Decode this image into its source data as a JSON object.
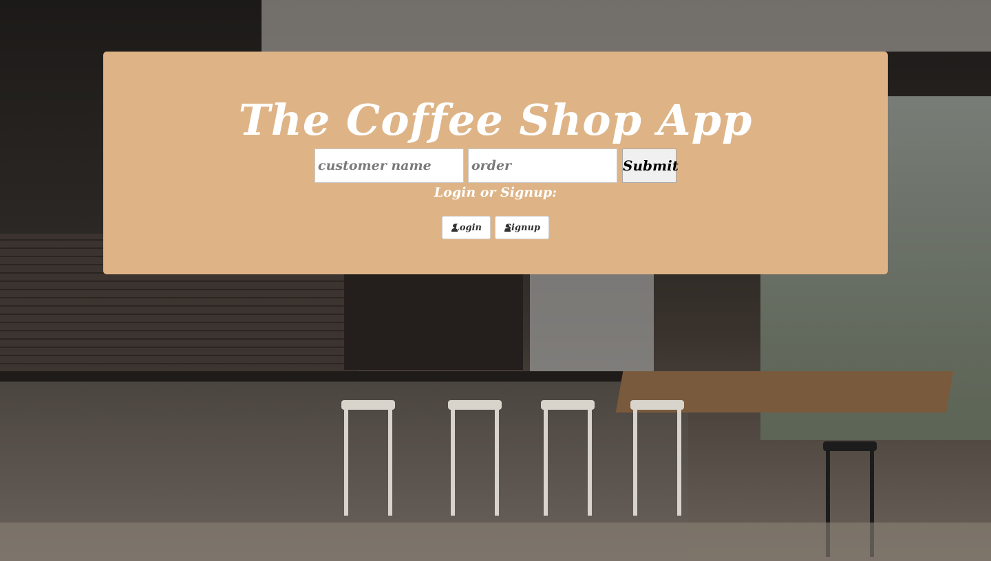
{
  "app": {
    "title": "The Coffee Shop App"
  },
  "order_form": {
    "customer_name_placeholder": "customer name",
    "order_placeholder": "order",
    "submit_label": "Submit"
  },
  "auth": {
    "prompt": "Login or Signup:",
    "login_label": "Login",
    "signup_label": "Signup",
    "icon": "user-icon"
  },
  "colors": {
    "panel_background": "#deb487",
    "title_text": "#ffffff"
  }
}
